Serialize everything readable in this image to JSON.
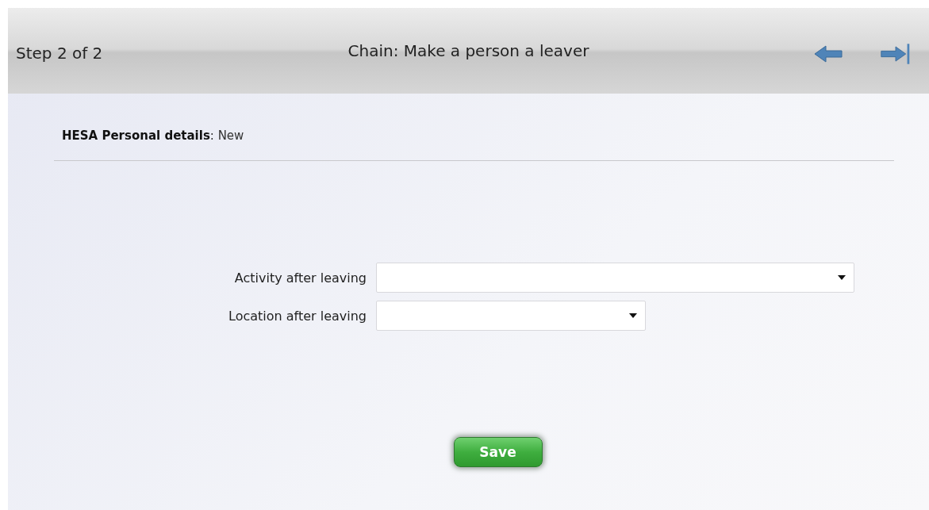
{
  "header": {
    "step": "Step 2 of 2",
    "title": "Chain: Make a person a leaver"
  },
  "section": {
    "heading": "**HESA Personal details**: New"
  },
  "fields": [
    {
      "label": "Activity after leaving",
      "kind": "dropdown"
    },
    {
      "label": "Location after leaving",
      "kind": "dropdown"
    }
  ],
  "buttons": [
    "Save"
  ]
}
